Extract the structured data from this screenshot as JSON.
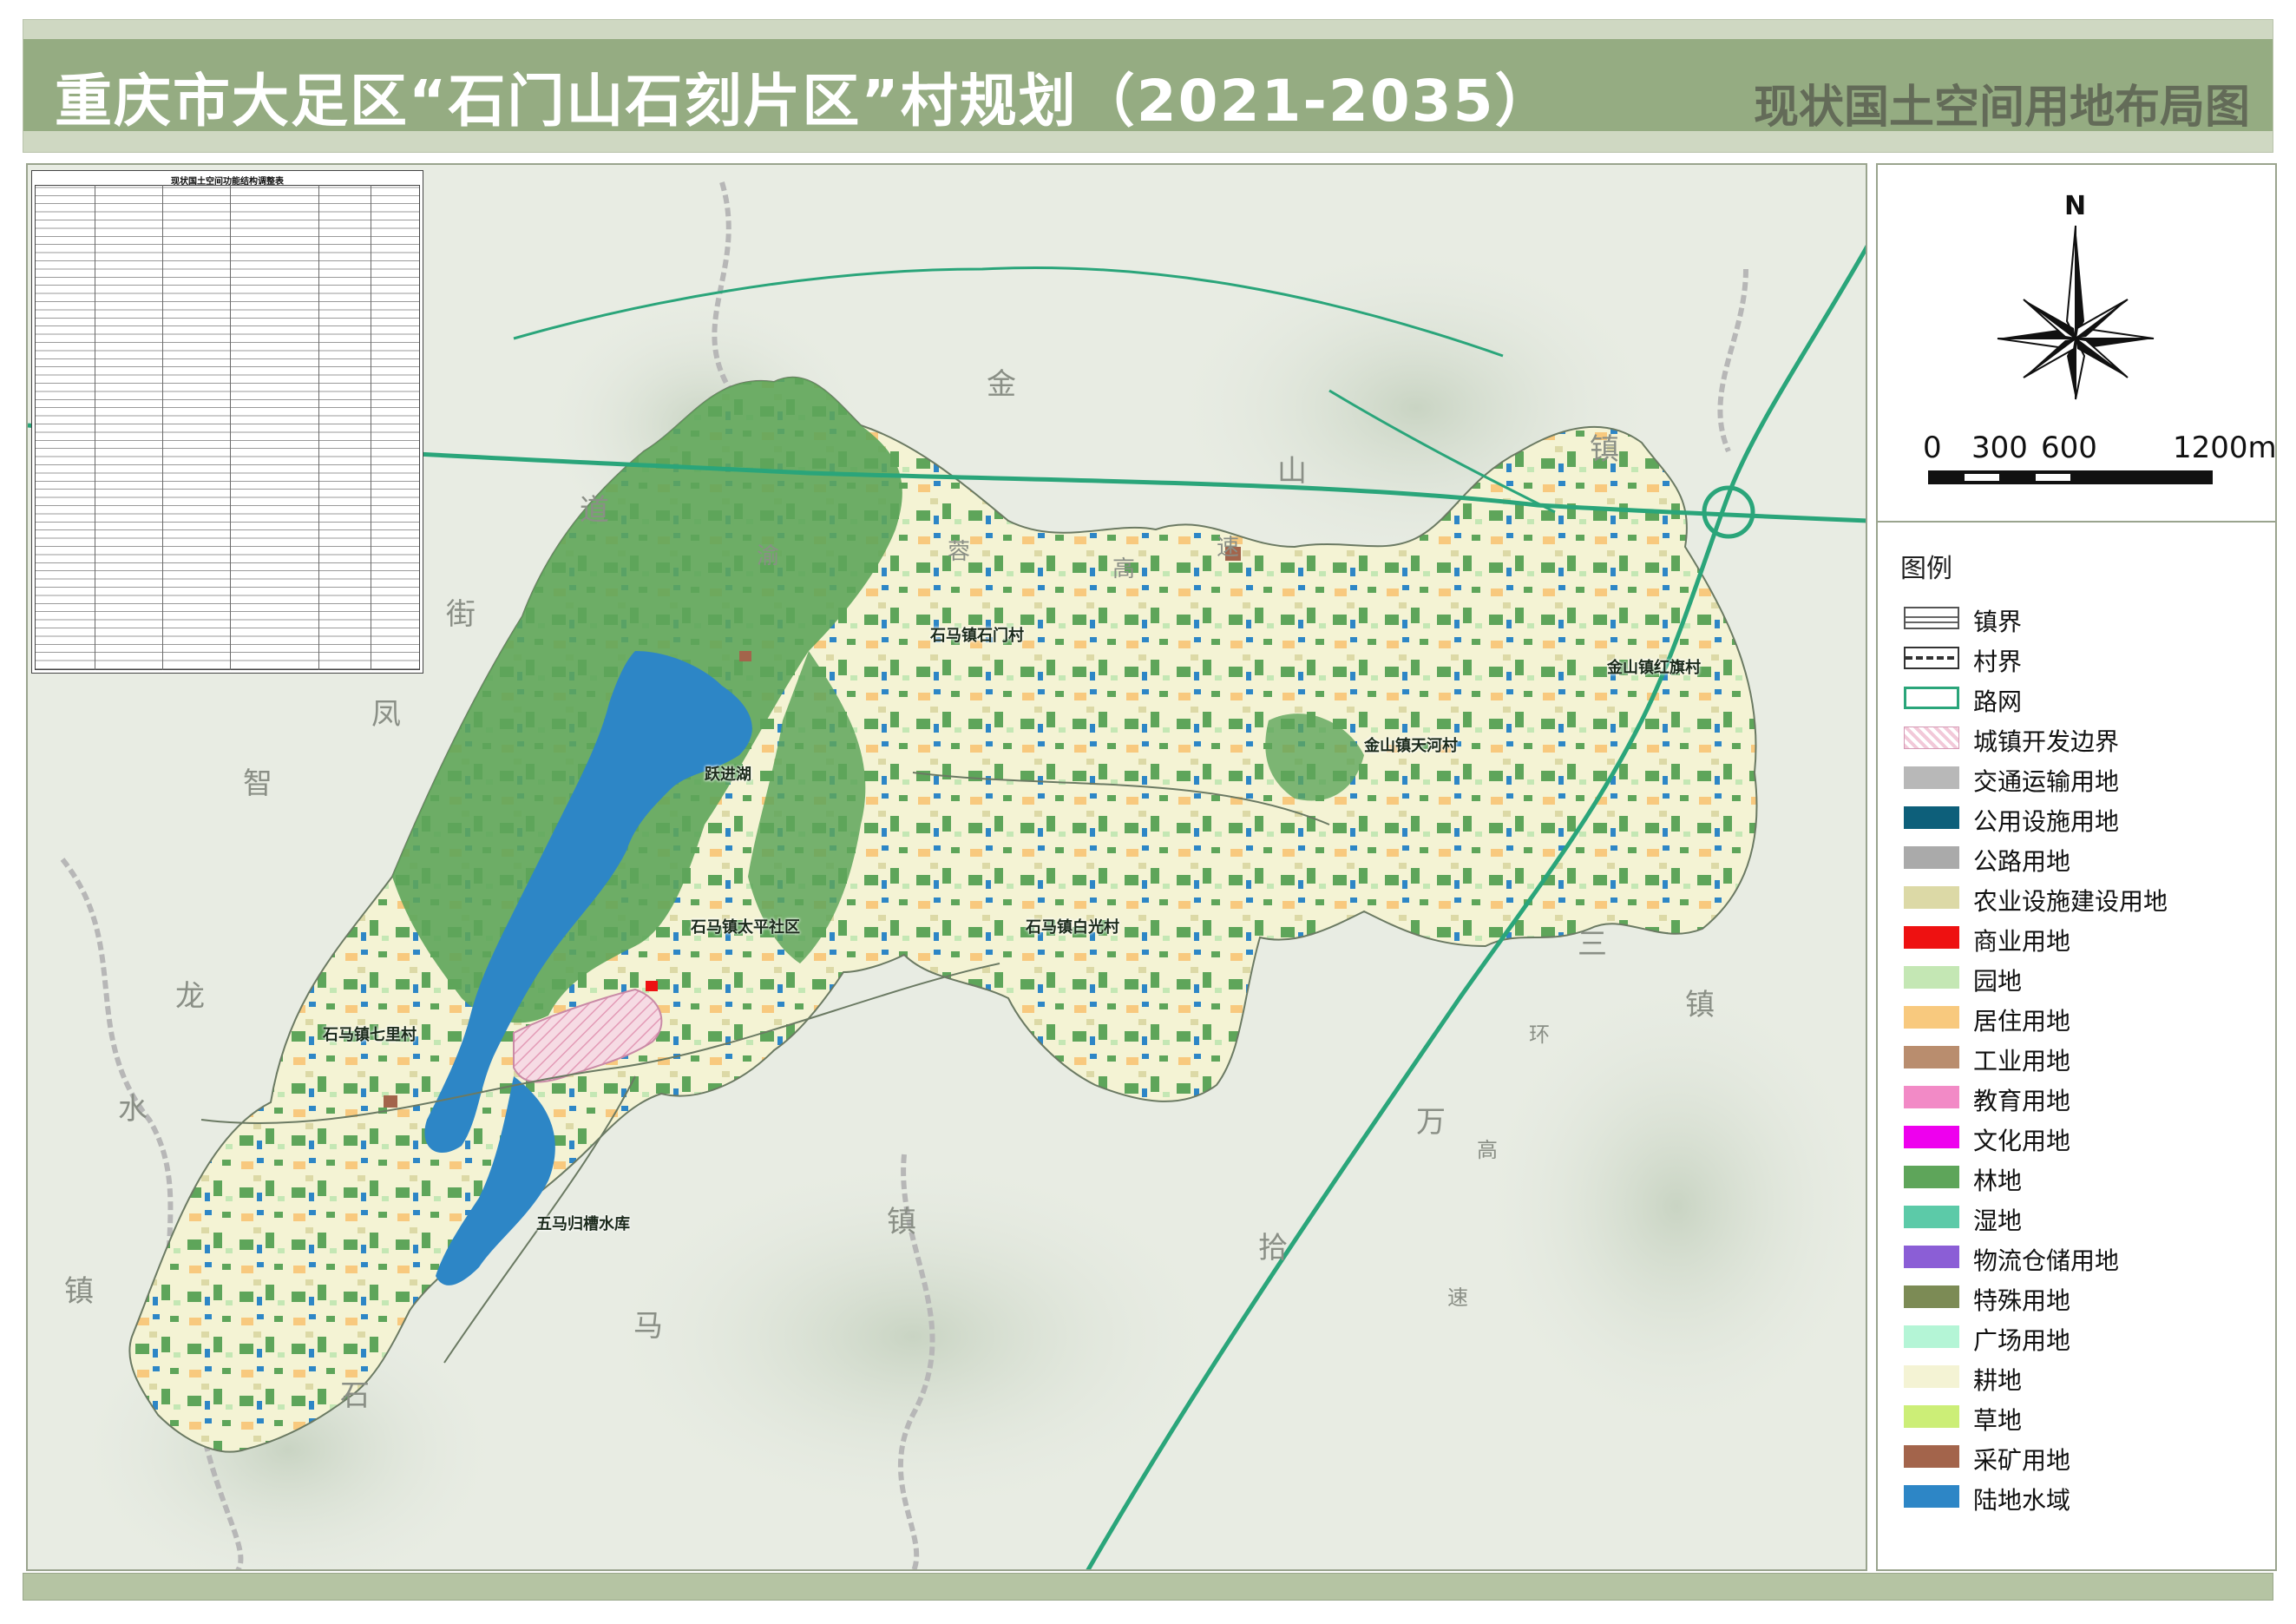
{
  "header": {
    "title": "重庆市大足区“石门山石刻片区”村规划（2021-2035）",
    "subtitle": "现状国土空间用地布局图"
  },
  "map": {
    "place_chars": [
      {
        "id": "jin",
        "text": "金"
      },
      {
        "id": "shan",
        "text": "山"
      },
      {
        "id": "zhen1",
        "text": "镇"
      },
      {
        "id": "dao",
        "text": "道"
      },
      {
        "id": "jie",
        "text": "街"
      },
      {
        "id": "feng",
        "text": "凤"
      },
      {
        "id": "zhi",
        "text": "智"
      },
      {
        "id": "long",
        "text": "龙"
      },
      {
        "id": "shui",
        "text": "水"
      },
      {
        "id": "zhen2",
        "text": "镇"
      },
      {
        "id": "zhen3",
        "text": "镇"
      },
      {
        "id": "ma",
        "text": "马"
      },
      {
        "id": "shi",
        "text": "石"
      },
      {
        "id": "shi2",
        "text": "拾"
      },
      {
        "id": "wan",
        "text": "万"
      },
      {
        "id": "san",
        "text": "三"
      },
      {
        "id": "zhen4",
        "text": "镇"
      }
    ],
    "road_chars": [
      {
        "id": "yu",
        "text": "渝"
      },
      {
        "id": "rong",
        "text": "蓉"
      },
      {
        "id": "gao",
        "text": "高"
      },
      {
        "id": "su",
        "text": "速"
      },
      {
        "id": "huan",
        "text": "环"
      },
      {
        "id": "gao2",
        "text": "高"
      },
      {
        "id": "su2",
        "text": "速"
      }
    ],
    "villages": [
      {
        "id": "shimen",
        "text": "石马镇石门村"
      },
      {
        "id": "hongqi",
        "text": "金山镇红旗村"
      },
      {
        "id": "tianhe",
        "text": "金山镇天河村"
      },
      {
        "id": "yuejin",
        "text": "跃进湖"
      },
      {
        "id": "taiping",
        "text": "石马镇太平社区"
      },
      {
        "id": "baiguang",
        "text": "石马镇白光村"
      },
      {
        "id": "qili",
        "text": "石马镇七里村"
      },
      {
        "id": "wuma",
        "text": "五马归槽水库"
      }
    ]
  },
  "table": {
    "title": "现状国土空间功能结构调整表"
  },
  "compass": {
    "north": "N"
  },
  "scale": {
    "labels": [
      "0",
      "300",
      "600",
      "1200m"
    ]
  },
  "legend": {
    "title": "图例",
    "items": [
      {
        "label": "镇界",
        "color": "#ffffff",
        "style": "line-double"
      },
      {
        "label": "村界",
        "color": "#ffffff",
        "style": "line-dash"
      },
      {
        "label": "路网",
        "color": "#2aa57a",
        "style": "line-road"
      },
      {
        "label": "城镇开发边界",
        "color": "#f2c9d9",
        "style": "hatch"
      },
      {
        "label": "交通运输用地",
        "color": "#b8b8b8",
        "style": "fill"
      },
      {
        "label": "公用设施用地",
        "color": "#0d5f7a",
        "style": "fill"
      },
      {
        "label": "公路用地",
        "color": "#aaaaaa",
        "style": "fill"
      },
      {
        "label": "农业设施建设用地",
        "color": "#dcd9a6",
        "style": "fill"
      },
      {
        "label": "商业用地",
        "color": "#ee1111",
        "style": "fill"
      },
      {
        "label": "园地",
        "color": "#c4e7b4",
        "style": "fill"
      },
      {
        "label": "居住用地",
        "color": "#f8c97e",
        "style": "fill"
      },
      {
        "label": "工业用地",
        "color": "#b98d6e",
        "style": "fill"
      },
      {
        "label": "教育用地",
        "color": "#f28ac6",
        "style": "fill"
      },
      {
        "label": "文化用地",
        "color": "#ee00ee",
        "style": "fill"
      },
      {
        "label": "林地",
        "color": "#5ea55a",
        "style": "fill"
      },
      {
        "label": "湿地",
        "color": "#5ccaa8",
        "style": "fill"
      },
      {
        "label": "物流仓储用地",
        "color": "#8b5ed6",
        "style": "fill"
      },
      {
        "label": "特殊用地",
        "color": "#7c8b55",
        "style": "fill"
      },
      {
        "label": "广场用地",
        "color": "#b4f5d6",
        "style": "fill"
      },
      {
        "label": "耕地",
        "color": "#f4f3d4",
        "style": "fill"
      },
      {
        "label": "草地",
        "color": "#ccee77",
        "style": "fill"
      },
      {
        "label": "采矿用地",
        "color": "#a3644b",
        "style": "fill"
      },
      {
        "label": "陆地水域",
        "color": "#2d86c6",
        "style": "fill"
      }
    ]
  }
}
